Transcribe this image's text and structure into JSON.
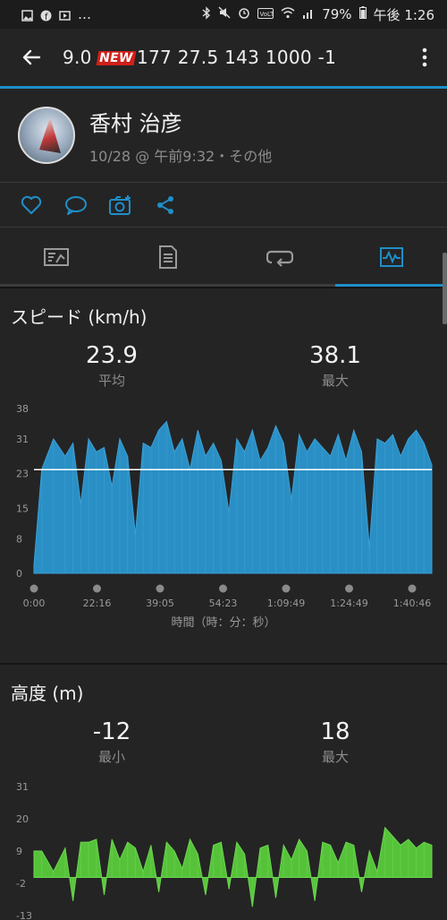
{
  "status": {
    "battery": "79%",
    "time": "午後 1:26"
  },
  "header": {
    "new_badge": "NEW",
    "title_before": "9.0 ",
    "title_after": "177  27.5  143  1000  -1"
  },
  "profile": {
    "name": "香村 治彦",
    "meta": "10/28 @ 午前9:32・その他"
  },
  "colors": {
    "accent": "#1f8ec8",
    "speed_fill": "#2a8fc4",
    "elevation_fill": "#55c23a"
  },
  "speed": {
    "title": "スピード (km/h)",
    "avg_value": "23.9",
    "avg_label": "平均",
    "max_value": "38.1",
    "max_label": "最大",
    "xlabel": "時間（時：分：秒）"
  },
  "elevation": {
    "title": "高度 (m)",
    "min_value": "-12",
    "min_label": "最小",
    "max_value": "18",
    "max_label": "最大"
  },
  "chart_data": [
    {
      "type": "area",
      "title": "スピード (km/h)",
      "xlabel": "時間（時：分：秒）",
      "ylabel": "",
      "ylim": [
        0,
        38
      ],
      "yticks": [
        0,
        8,
        15,
        23,
        31,
        38
      ],
      "xticks": [
        "0:00",
        "22:16",
        "39:05",
        "54:23",
        "1:09:49",
        "1:24:49",
        "1:40:46"
      ],
      "x_minutes": [
        0,
        2,
        5,
        8,
        10,
        12,
        14,
        16,
        18,
        20,
        22,
        24,
        26,
        28,
        30,
        32,
        34,
        36,
        38,
        40,
        42,
        44,
        46,
        48,
        50,
        52,
        54,
        56,
        58,
        60,
        62,
        64,
        66,
        68,
        70,
        72,
        74,
        76,
        78,
        80,
        82,
        84,
        86,
        88,
        90,
        92,
        94,
        96,
        98,
        100,
        102
      ],
      "values": [
        2,
        24,
        31,
        27,
        30,
        16,
        31,
        28,
        29,
        20,
        31,
        27,
        9,
        30,
        29,
        33,
        35,
        28,
        31,
        24,
        33,
        27,
        30,
        26,
        14,
        31,
        28,
        33,
        26,
        29,
        34,
        30,
        17,
        32,
        28,
        31,
        29,
        27,
        32,
        26,
        33,
        28,
        6,
        31,
        30,
        32,
        27,
        31,
        33,
        30,
        25
      ],
      "reference_line": 23.9,
      "grid": false
    },
    {
      "type": "area",
      "title": "高度 (m)",
      "ylim": [
        -13,
        31
      ],
      "yticks": [
        -13,
        -2,
        9,
        20,
        31
      ],
      "x_minutes": [
        0,
        2,
        5,
        8,
        10,
        12,
        14,
        16,
        18,
        20,
        22,
        24,
        26,
        28,
        30,
        32,
        34,
        36,
        38,
        40,
        42,
        44,
        46,
        48,
        50,
        52,
        54,
        56,
        58,
        60,
        62,
        64,
        66,
        68,
        70,
        72,
        74,
        76,
        78,
        80,
        82,
        84,
        86,
        88,
        90,
        92,
        94,
        96,
        98,
        100,
        102
      ],
      "values": [
        9,
        9,
        2,
        10,
        -8,
        12,
        12,
        13,
        -6,
        13,
        6,
        12,
        10,
        2,
        11,
        -5,
        12,
        9,
        3,
        13,
        8,
        -6,
        11,
        12,
        -4,
        12,
        8,
        -10,
        10,
        11,
        -7,
        11,
        6,
        13,
        9,
        -8,
        12,
        11,
        5,
        12,
        11,
        -5,
        9,
        2,
        17,
        14,
        11,
        13,
        10,
        12,
        11
      ],
      "grid": false
    }
  ]
}
